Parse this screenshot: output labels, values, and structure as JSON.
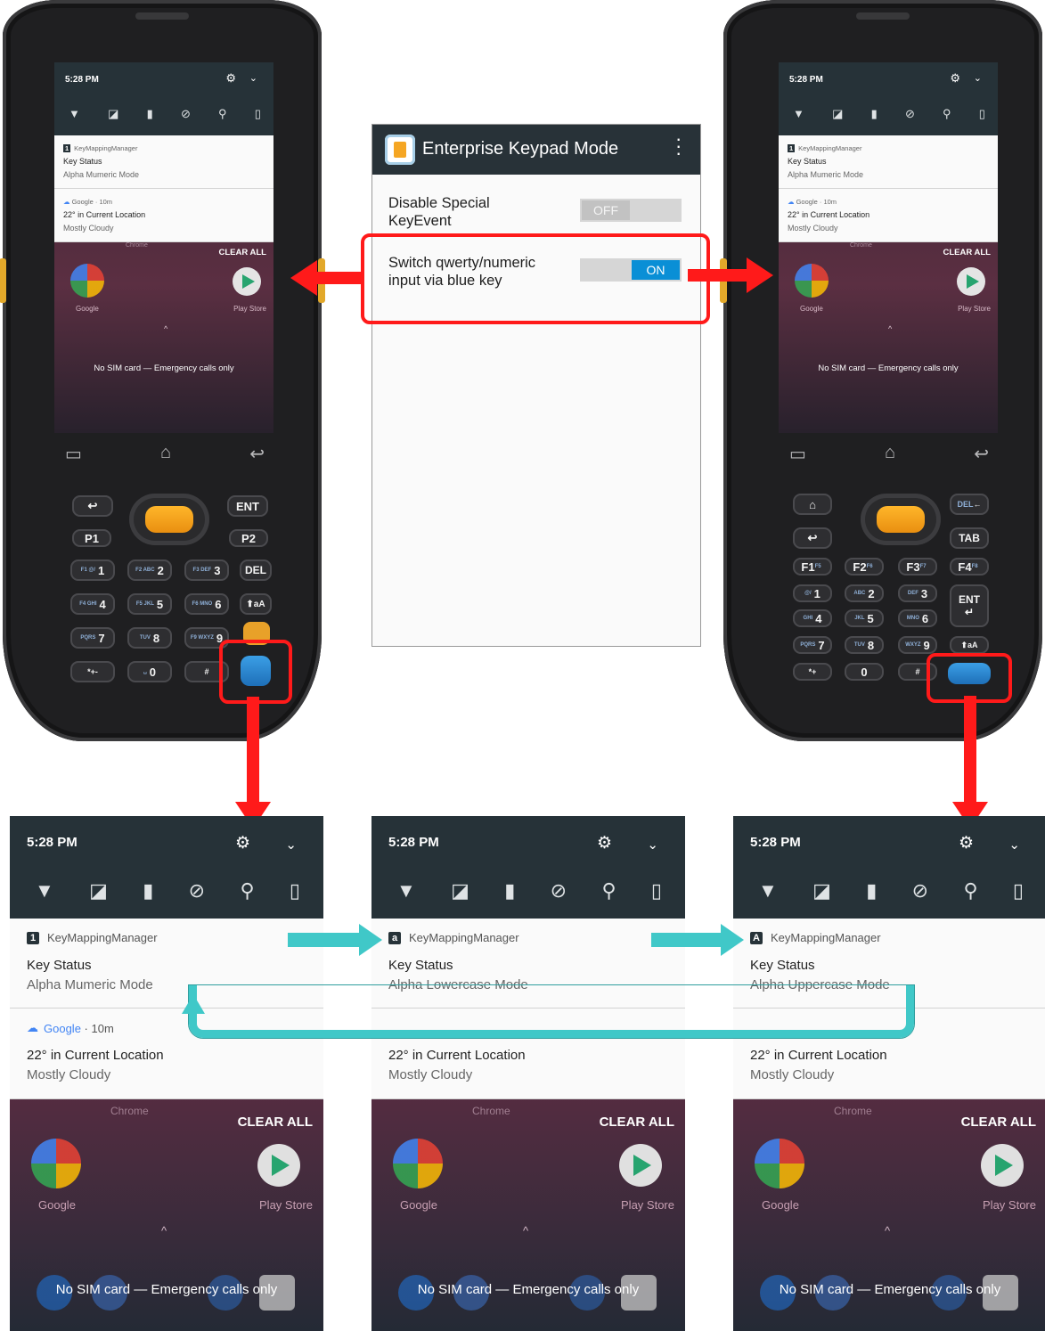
{
  "colors": {
    "accent_red": "#ff1a1a",
    "accent_teal": "#40c8c8",
    "statusbar": "#263238",
    "toggle_on": "#0a8fd6",
    "toggle_off": "#e0e0e0"
  },
  "panel": {
    "title": "Enterprise Keypad Mode",
    "menu_icon": "overflow-menu-icon",
    "settings": [
      {
        "label_line1": "Disable Special",
        "label_line2": "KeyEvent",
        "toggle": "OFF",
        "state": false
      },
      {
        "label_line1": "Switch qwerty/numeric",
        "label_line2": "input via blue key",
        "toggle": "ON",
        "state": true
      }
    ]
  },
  "notification_shade": {
    "time": "5:28 PM",
    "app_name": "KeyMappingManager",
    "key_status_title": "Key Status",
    "weather_app": "Google",
    "weather_age": "10m",
    "weather_title": "22° in Current Location",
    "weather_sub": "Mostly Cloudy",
    "chrome_label": "Chrome",
    "clear_all": "CLEAR ALL",
    "google_label": "Google",
    "playstore_label": "Play Store",
    "sim_text": "No SIM card — Emergency calls only",
    "status_icons": [
      "wifi-icon",
      "no-sim-icon",
      "battery-icon",
      "do-not-disturb-icon",
      "flashlight-off-icon",
      "phone-orientation-icon"
    ]
  },
  "modes": [
    {
      "badge": "1",
      "label": "Alpha Mumeric Mode"
    },
    {
      "badge": "a",
      "label": "Alpha Lowercase Mode"
    },
    {
      "badge": "A",
      "label": "Alpha Uppercase Mode"
    }
  ],
  "device_left": {
    "mode_badge": "1",
    "mode": "Alpha Mumeric Mode",
    "keys": {
      "enter": "ENT",
      "p1": "P1",
      "p2": "P2",
      "del": "DEL",
      "k1": "1",
      "k2": "2",
      "k3": "3",
      "k4": "4",
      "k5": "5",
      "k6": "6",
      "k7": "7",
      "k8": "8",
      "k9": "9",
      "k0": "0",
      "shift": "aA",
      "sub1": "F1 @/",
      "sub2": "F2 ABC",
      "sub3": "F3 DEF",
      "sub4": "F4 GHI",
      "sub5": "F5 JKL",
      "sub6": "F6 MNO",
      "sub7": "PQRS",
      "sub8": "TUV",
      "sub9": "F9 WXYZ",
      "star": "*+-",
      "zero_sub": "␣",
      "hash": "#"
    }
  },
  "device_right": {
    "mode_badge": "1",
    "mode": "Alpha Mumeric Mode",
    "keys": {
      "del": "DEL",
      "tab": "TAB",
      "f1": "F1",
      "f2": "F2",
      "f3": "F3",
      "f4": "F4",
      "ent": "ENT",
      "k1": "1",
      "k2": "2",
      "k3": "3",
      "k4": "4",
      "k5": "5",
      "k6": "6",
      "k7": "7",
      "k8": "8",
      "k9": "9",
      "k0": "0",
      "shift": "aA",
      "f5": "F5",
      "f6": "F6",
      "f7": "F7",
      "f8": "F8",
      "sub1": "@/",
      "sub2": "ABC",
      "sub3": "DEF",
      "sub4": "GHI",
      "sub5": "JKL",
      "sub6": "MNO",
      "sub7": "PQRS",
      "sub8": "TUV",
      "sub9": "WXYZ",
      "star": "*+",
      "hash": "#"
    }
  }
}
